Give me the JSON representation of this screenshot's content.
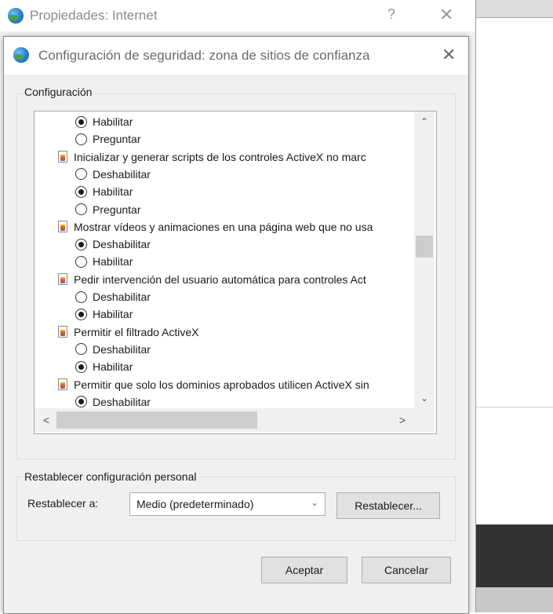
{
  "back_window": {
    "title": "Propiedades: Internet",
    "help": "?",
    "close": "✕"
  },
  "dialog": {
    "title": "Configuración de seguridad: zona de sitios de confianza",
    "close": "✕",
    "settings_label": "Configuración",
    "list": [
      {
        "kind": "opt",
        "label": "Habilitar",
        "checked": true
      },
      {
        "kind": "opt",
        "label": "Preguntar",
        "checked": false
      },
      {
        "kind": "head",
        "label": "Inicializar y generar scripts de los controles ActiveX no marc"
      },
      {
        "kind": "opt",
        "label": "Deshabilitar",
        "checked": false
      },
      {
        "kind": "opt",
        "label": "Habilitar",
        "checked": true
      },
      {
        "kind": "opt",
        "label": "Preguntar",
        "checked": false
      },
      {
        "kind": "head",
        "label": "Mostrar vídeos y animaciones en una página web que no usa"
      },
      {
        "kind": "opt",
        "label": "Deshabilitar",
        "checked": true
      },
      {
        "kind": "opt",
        "label": "Habilitar",
        "checked": false
      },
      {
        "kind": "head",
        "label": "Pedir intervención del usuario automática para controles Act"
      },
      {
        "kind": "opt",
        "label": "Deshabilitar",
        "checked": false
      },
      {
        "kind": "opt",
        "label": "Habilitar",
        "checked": true
      },
      {
        "kind": "head",
        "label": "Permitir el filtrado ActiveX"
      },
      {
        "kind": "opt",
        "label": "Deshabilitar",
        "checked": false
      },
      {
        "kind": "opt",
        "label": "Habilitar",
        "checked": true
      },
      {
        "kind": "head",
        "label": "Permitir que solo los dominios aprobados utilicen ActiveX sin"
      },
      {
        "kind": "opt",
        "label": "Deshabilitar",
        "checked": true
      }
    ],
    "scroll": {
      "up": "⌃",
      "down": "⌄",
      "left": "<",
      "right": ">"
    },
    "reset_group_label": "Restablecer configuración personal",
    "reset_to_label": "Restablecer a:",
    "reset_select_value": "Medio (predeterminado)",
    "reset_button": "Restablecer...",
    "ok_button": "Aceptar",
    "cancel_button": "Cancelar"
  }
}
